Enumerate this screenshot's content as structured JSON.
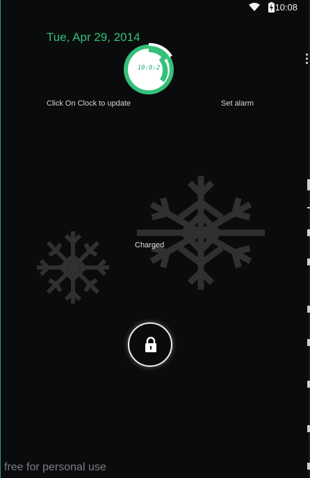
{
  "status_bar": {
    "time": "10:08",
    "wifi_icon": "wifi-icon",
    "battery_icon": "battery-charging-icon"
  },
  "lockscreen": {
    "date": "Tue, Apr 29, 2014",
    "clock": {
      "time": "10:8:2",
      "accent_color": "#35c07a"
    },
    "hint": "Click On Clock to update",
    "set_alarm": "Set alarm",
    "charge_status": "Charged",
    "unlock_icon": "padlock-icon",
    "decorations": [
      "snowflake-icon",
      "snowflake-icon"
    ]
  },
  "footer": {
    "watermark": "free for personal use"
  },
  "colors": {
    "background": "#0a0b0c",
    "accent": "#35c07a",
    "snowflake": "#2f3030",
    "text": "#d6d6d6"
  }
}
